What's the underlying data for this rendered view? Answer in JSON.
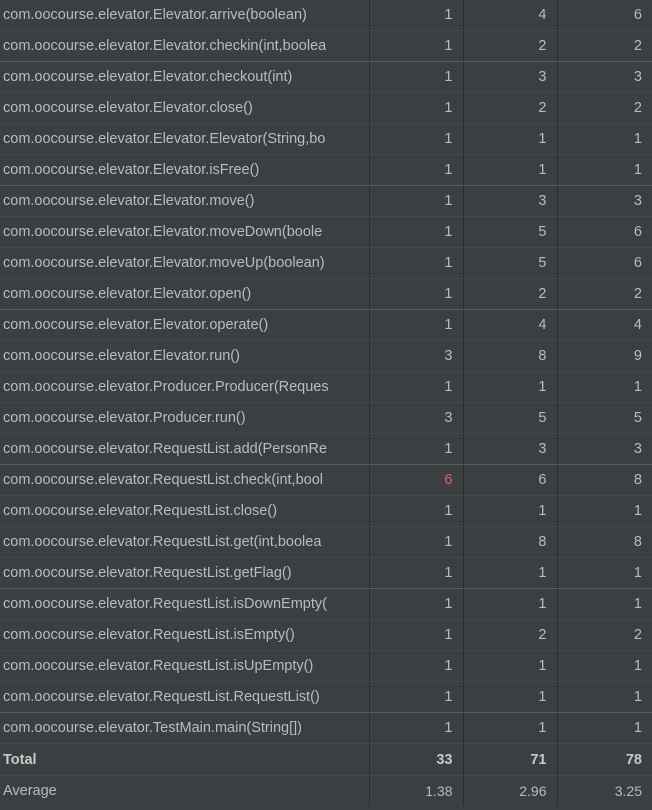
{
  "rows": [
    {
      "method": "com.oocourse.elevator.Elevator.arrive(boolean)",
      "v1": "1",
      "v2": "4",
      "v3": "6"
    },
    {
      "method": "com.oocourse.elevator.Elevator.checkin(int,boolea",
      "v1": "1",
      "v2": "2",
      "v3": "2"
    },
    {
      "method": "com.oocourse.elevator.Elevator.checkout(int)",
      "v1": "1",
      "v2": "3",
      "v3": "3"
    },
    {
      "method": "com.oocourse.elevator.Elevator.close()",
      "v1": "1",
      "v2": "2",
      "v3": "2"
    },
    {
      "method": "com.oocourse.elevator.Elevator.Elevator(String,bo",
      "v1": "1",
      "v2": "1",
      "v3": "1"
    },
    {
      "method": "com.oocourse.elevator.Elevator.isFree()",
      "v1": "1",
      "v2": "1",
      "v3": "1"
    },
    {
      "method": "com.oocourse.elevator.Elevator.move()",
      "v1": "1",
      "v2": "3",
      "v3": "3"
    },
    {
      "method": "com.oocourse.elevator.Elevator.moveDown(boole",
      "v1": "1",
      "v2": "5",
      "v3": "6"
    },
    {
      "method": "com.oocourse.elevator.Elevator.moveUp(boolean)",
      "v1": "1",
      "v2": "5",
      "v3": "6"
    },
    {
      "method": "com.oocourse.elevator.Elevator.open()",
      "v1": "1",
      "v2": "2",
      "v3": "2"
    },
    {
      "method": "com.oocourse.elevator.Elevator.operate()",
      "v1": "1",
      "v2": "4",
      "v3": "4"
    },
    {
      "method": "com.oocourse.elevator.Elevator.run()",
      "v1": "3",
      "v2": "8",
      "v3": "9"
    },
    {
      "method": "com.oocourse.elevator.Producer.Producer(Reques",
      "v1": "1",
      "v2": "1",
      "v3": "1"
    },
    {
      "method": "com.oocourse.elevator.Producer.run()",
      "v1": "3",
      "v2": "5",
      "v3": "5"
    },
    {
      "method": "com.oocourse.elevator.RequestList.add(PersonRe",
      "v1": "1",
      "v2": "3",
      "v3": "3"
    },
    {
      "method": "com.oocourse.elevator.RequestList.check(int,bool",
      "v1": "6",
      "v2": "6",
      "v3": "8",
      "highlight": true
    },
    {
      "method": "com.oocourse.elevator.RequestList.close()",
      "v1": "1",
      "v2": "1",
      "v3": "1"
    },
    {
      "method": "com.oocourse.elevator.RequestList.get(int,boolea",
      "v1": "1",
      "v2": "8",
      "v3": "8"
    },
    {
      "method": "com.oocourse.elevator.RequestList.getFlag()",
      "v1": "1",
      "v2": "1",
      "v3": "1"
    },
    {
      "method": "com.oocourse.elevator.RequestList.isDownEmpty(",
      "v1": "1",
      "v2": "1",
      "v3": "1"
    },
    {
      "method": "com.oocourse.elevator.RequestList.isEmpty()",
      "v1": "1",
      "v2": "2",
      "v3": "2"
    },
    {
      "method": "com.oocourse.elevator.RequestList.isUpEmpty()",
      "v1": "1",
      "v2": "1",
      "v3": "1"
    },
    {
      "method": "com.oocourse.elevator.RequestList.RequestList()",
      "v1": "1",
      "v2": "1",
      "v3": "1"
    },
    {
      "method": "com.oocourse.elevator.TestMain.main(String[])",
      "v1": "1",
      "v2": "1",
      "v3": "1"
    }
  ],
  "total": {
    "label": "Total",
    "v1": "33",
    "v2": "71",
    "v3": "78"
  },
  "average": {
    "label": "Average",
    "v1": "1.38",
    "v2": "2.96",
    "v3": "3.25"
  },
  "colors": {
    "background": "#3c3f41",
    "text": "#bbbbbb",
    "highlight": "#e85c5c"
  }
}
